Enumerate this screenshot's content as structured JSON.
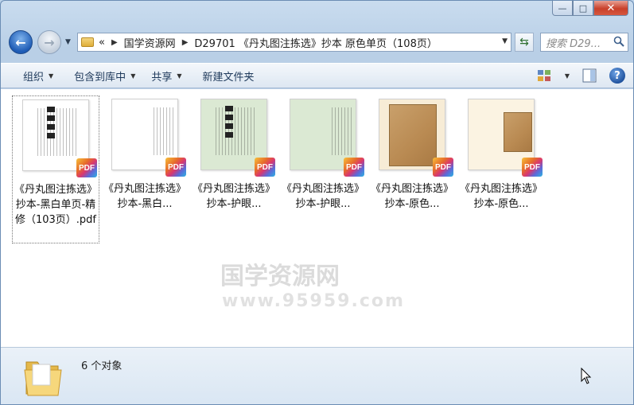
{
  "window": {
    "caption_buttons": {
      "minimize": "—",
      "maximize": "□",
      "close": "✕"
    }
  },
  "navigation": {
    "back_icon": "arrow-left-icon",
    "forward_icon": "arrow-right-icon",
    "breadcrumb_prefix": "«",
    "breadcrumbs": [
      "国学资源网",
      "D29701 《丹丸图注拣选》抄本 原色单页（108页）"
    ],
    "search_placeholder": "搜索 D29..."
  },
  "toolbar": {
    "organize": "组织",
    "include_library": "包含到库中",
    "share": "共享",
    "new_folder": "新建文件夹"
  },
  "files": [
    {
      "name": "《丹丸图注拣选》抄本-黑白单页-精修（103页）.pdf",
      "display": "《丹丸图注拣选》抄本-黑白单页-精修（103页）.pdf",
      "badge": "PDF",
      "page_color": "#ffffff",
      "style": "bw-text",
      "selected": true
    },
    {
      "name": "《丹丸图注拣选》抄本-黑白...",
      "display": "《丹丸图注拣选》抄本-黑白...",
      "badge": "PDF",
      "page_color": "#ffffff",
      "style": "bw-double",
      "selected": false
    },
    {
      "name": "《丹丸图注拣选》抄本-护眼...",
      "display": "《丹丸图注拣选》抄本-护眼...",
      "badge": "PDF",
      "page_color": "#dbe9d3",
      "style": "green-text",
      "selected": false
    },
    {
      "name": "《丹丸图注拣选》抄本-护眼...",
      "display": "《丹丸图注拣选》抄本-护眼...",
      "badge": "PDF",
      "page_color": "#dbe9d3",
      "style": "green-double",
      "selected": false
    },
    {
      "name": "《丹丸图注拣选》抄本-原色...",
      "display": "《丹丸图注拣选》抄本-原色...",
      "badge": "PDF",
      "page_color": "#f7ecd6",
      "style": "scan",
      "selected": false
    },
    {
      "name": "《丹丸图注拣选》抄本-原色...",
      "display": "《丹丸图注拣选》抄本-原色...",
      "badge": "PDF",
      "page_color": "#fbf3e2",
      "style": "scan-double",
      "selected": false
    }
  ],
  "status": {
    "count_text": "6 个对象"
  },
  "watermark": {
    "line1": "国学资源网",
    "line2": "www.95959.com"
  },
  "colors": {
    "accent": "#1d5bb5",
    "close_button": "#c8402a",
    "toolbar_text": "#1e395b"
  }
}
